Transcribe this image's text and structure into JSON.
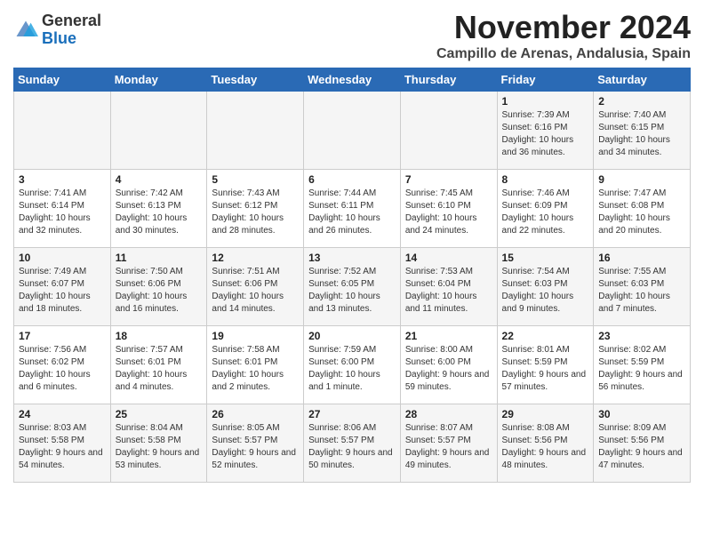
{
  "logo": {
    "general": "General",
    "blue": "Blue"
  },
  "title": "November 2024",
  "location": "Campillo de Arenas, Andalusia, Spain",
  "weekdays": [
    "Sunday",
    "Monday",
    "Tuesday",
    "Wednesday",
    "Thursday",
    "Friday",
    "Saturday"
  ],
  "weeks": [
    [
      {
        "day": "",
        "info": ""
      },
      {
        "day": "",
        "info": ""
      },
      {
        "day": "",
        "info": ""
      },
      {
        "day": "",
        "info": ""
      },
      {
        "day": "",
        "info": ""
      },
      {
        "day": "1",
        "info": "Sunrise: 7:39 AM\nSunset: 6:16 PM\nDaylight: 10 hours and 36 minutes."
      },
      {
        "day": "2",
        "info": "Sunrise: 7:40 AM\nSunset: 6:15 PM\nDaylight: 10 hours and 34 minutes."
      }
    ],
    [
      {
        "day": "3",
        "info": "Sunrise: 7:41 AM\nSunset: 6:14 PM\nDaylight: 10 hours and 32 minutes."
      },
      {
        "day": "4",
        "info": "Sunrise: 7:42 AM\nSunset: 6:13 PM\nDaylight: 10 hours and 30 minutes."
      },
      {
        "day": "5",
        "info": "Sunrise: 7:43 AM\nSunset: 6:12 PM\nDaylight: 10 hours and 28 minutes."
      },
      {
        "day": "6",
        "info": "Sunrise: 7:44 AM\nSunset: 6:11 PM\nDaylight: 10 hours and 26 minutes."
      },
      {
        "day": "7",
        "info": "Sunrise: 7:45 AM\nSunset: 6:10 PM\nDaylight: 10 hours and 24 minutes."
      },
      {
        "day": "8",
        "info": "Sunrise: 7:46 AM\nSunset: 6:09 PM\nDaylight: 10 hours and 22 minutes."
      },
      {
        "day": "9",
        "info": "Sunrise: 7:47 AM\nSunset: 6:08 PM\nDaylight: 10 hours and 20 minutes."
      }
    ],
    [
      {
        "day": "10",
        "info": "Sunrise: 7:49 AM\nSunset: 6:07 PM\nDaylight: 10 hours and 18 minutes."
      },
      {
        "day": "11",
        "info": "Sunrise: 7:50 AM\nSunset: 6:06 PM\nDaylight: 10 hours and 16 minutes."
      },
      {
        "day": "12",
        "info": "Sunrise: 7:51 AM\nSunset: 6:06 PM\nDaylight: 10 hours and 14 minutes."
      },
      {
        "day": "13",
        "info": "Sunrise: 7:52 AM\nSunset: 6:05 PM\nDaylight: 10 hours and 13 minutes."
      },
      {
        "day": "14",
        "info": "Sunrise: 7:53 AM\nSunset: 6:04 PM\nDaylight: 10 hours and 11 minutes."
      },
      {
        "day": "15",
        "info": "Sunrise: 7:54 AM\nSunset: 6:03 PM\nDaylight: 10 hours and 9 minutes."
      },
      {
        "day": "16",
        "info": "Sunrise: 7:55 AM\nSunset: 6:03 PM\nDaylight: 10 hours and 7 minutes."
      }
    ],
    [
      {
        "day": "17",
        "info": "Sunrise: 7:56 AM\nSunset: 6:02 PM\nDaylight: 10 hours and 6 minutes."
      },
      {
        "day": "18",
        "info": "Sunrise: 7:57 AM\nSunset: 6:01 PM\nDaylight: 10 hours and 4 minutes."
      },
      {
        "day": "19",
        "info": "Sunrise: 7:58 AM\nSunset: 6:01 PM\nDaylight: 10 hours and 2 minutes."
      },
      {
        "day": "20",
        "info": "Sunrise: 7:59 AM\nSunset: 6:00 PM\nDaylight: 10 hours and 1 minute."
      },
      {
        "day": "21",
        "info": "Sunrise: 8:00 AM\nSunset: 6:00 PM\nDaylight: 9 hours and 59 minutes."
      },
      {
        "day": "22",
        "info": "Sunrise: 8:01 AM\nSunset: 5:59 PM\nDaylight: 9 hours and 57 minutes."
      },
      {
        "day": "23",
        "info": "Sunrise: 8:02 AM\nSunset: 5:59 PM\nDaylight: 9 hours and 56 minutes."
      }
    ],
    [
      {
        "day": "24",
        "info": "Sunrise: 8:03 AM\nSunset: 5:58 PM\nDaylight: 9 hours and 54 minutes."
      },
      {
        "day": "25",
        "info": "Sunrise: 8:04 AM\nSunset: 5:58 PM\nDaylight: 9 hours and 53 minutes."
      },
      {
        "day": "26",
        "info": "Sunrise: 8:05 AM\nSunset: 5:57 PM\nDaylight: 9 hours and 52 minutes."
      },
      {
        "day": "27",
        "info": "Sunrise: 8:06 AM\nSunset: 5:57 PM\nDaylight: 9 hours and 50 minutes."
      },
      {
        "day": "28",
        "info": "Sunrise: 8:07 AM\nSunset: 5:57 PM\nDaylight: 9 hours and 49 minutes."
      },
      {
        "day": "29",
        "info": "Sunrise: 8:08 AM\nSunset: 5:56 PM\nDaylight: 9 hours and 48 minutes."
      },
      {
        "day": "30",
        "info": "Sunrise: 8:09 AM\nSunset: 5:56 PM\nDaylight: 9 hours and 47 minutes."
      }
    ]
  ]
}
